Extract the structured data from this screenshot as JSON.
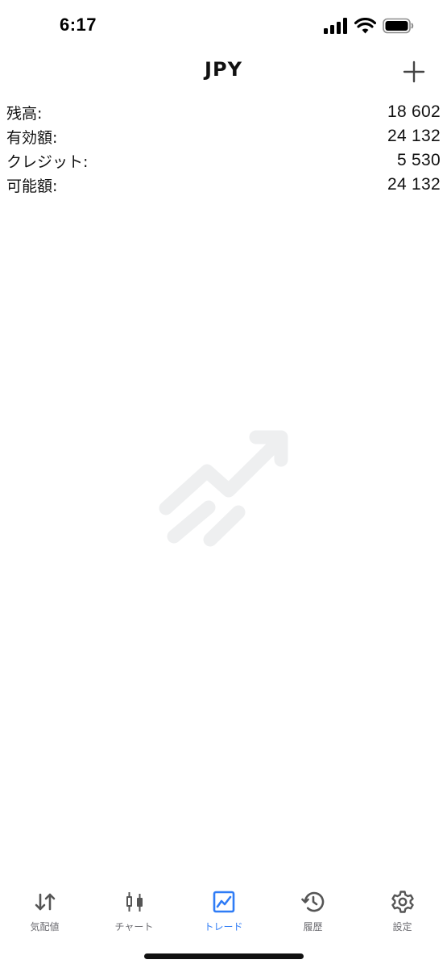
{
  "status_bar": {
    "time": "6:17",
    "icons": [
      "cellular-signal-icon",
      "wifi-icon",
      "battery-icon"
    ]
  },
  "header": {
    "title": "JPY",
    "add_icon": "plus-icon"
  },
  "balance": [
    {
      "label": "残高:",
      "value": "18 602"
    },
    {
      "label": "有効額:",
      "value": "24 132"
    },
    {
      "label": "クレジット:",
      "value": "5 530"
    },
    {
      "label": "可能額:",
      "value": "24 132"
    }
  ],
  "empty_state": {
    "icon": "trade-trend-icon"
  },
  "tabs": [
    {
      "label": "気配値",
      "icon": "quotes-arrows-icon",
      "active": false
    },
    {
      "label": "チャート",
      "icon": "chart-candles-icon",
      "active": false
    },
    {
      "label": "トレード",
      "icon": "trade-chart-icon",
      "active": true
    },
    {
      "label": "履歴",
      "icon": "history-icon",
      "active": false
    },
    {
      "label": "設定",
      "icon": "settings-gear-icon",
      "active": false
    }
  ],
  "colors": {
    "accent": "#2f7cf6",
    "tab_inactive": "#6e6e73",
    "empty_icon": "#eeeff0"
  }
}
